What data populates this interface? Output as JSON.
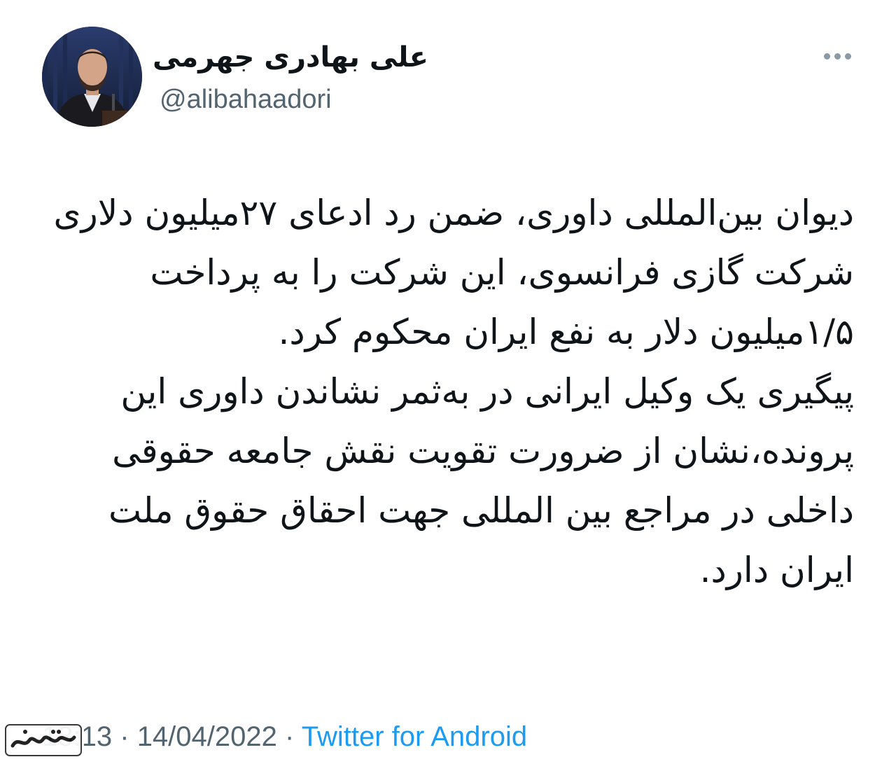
{
  "author": {
    "display_name": "علی بهادری جهرمی",
    "handle": "@alibahaadori"
  },
  "menu": {
    "icon": "more-horizontal-icon"
  },
  "tweet": {
    "paragraph_1": "دیوان بین‌المللی داوری، ضمن رد ادعای ۲۷میلیون دلاری شرکت گازی فرانسوی، این شرکت را به پرداخت ۱/۵میلیون دلار به نفع ایران محکوم کرد.",
    "paragraph_2": "پیگیری یک وکیل ایرانی در به‌ثمر نشاندن داوری این پرونده،نشان از ضرورت تقویت نقش جامعه حقوقی داخلی در مراجع بین المللی جهت احقاق حقوق ملت ایران دارد."
  },
  "meta": {
    "time": "18:13",
    "separator": "·",
    "date": "14/04/2022",
    "source": "Twitter for Android"
  },
  "watermark": {
    "text": "نفت ما"
  },
  "colors": {
    "text": "#0f1419",
    "secondary": "#536471",
    "link": "#1d9bf0"
  }
}
